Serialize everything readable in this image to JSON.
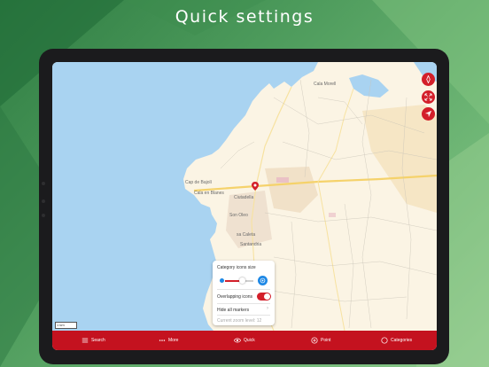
{
  "headline": "Quick settings",
  "colors": {
    "accent": "#d31f2a",
    "tabbar": "#c4121f",
    "sea": "#a9d3f1",
    "land": "#fbf4e4",
    "knob_blue": "#1e88e5"
  },
  "map": {
    "labels": [
      "Cala Morell",
      "Cap de Bajolí",
      "Cala en Blanes",
      "Ciutadella",
      "Son Oleo",
      "sa Caleta",
      "Santandria"
    ],
    "scale_label": "1 km"
  },
  "fabs": [
    {
      "name": "compass-button",
      "icon": "compass-icon"
    },
    {
      "name": "fullscreen-button",
      "icon": "fullscreen-icon"
    },
    {
      "name": "locate-button",
      "icon": "location-arrow-icon"
    }
  ],
  "quick_panel": {
    "title": "Category icons size",
    "size_value_fraction": 0.62,
    "overlapping_label": "Overlapping icons",
    "overlapping_on": true,
    "hide_markers_label": "Hide all markers",
    "zoom_label": "Current zoom level: 12"
  },
  "tabs": [
    {
      "label": "Search",
      "icon": "list-icon"
    },
    {
      "label": "More",
      "icon": "dots-icon"
    },
    {
      "label": "Quick",
      "icon": "eye-icon"
    },
    {
      "label": "Point",
      "icon": "plus-circle-icon"
    },
    {
      "label": "Categories",
      "icon": "circle-icon"
    }
  ]
}
